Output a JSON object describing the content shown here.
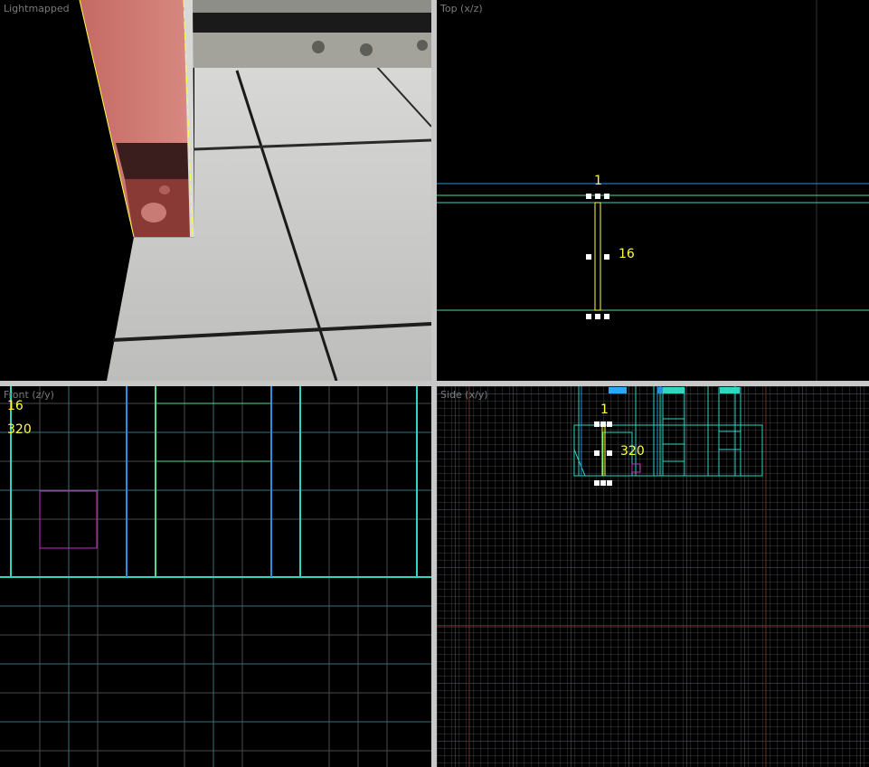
{
  "viewports": {
    "camera_3d": {
      "title": "Lightmapped"
    },
    "top": {
      "title": "Top (x/z)",
      "dim_width": "1",
      "dim_height": "16"
    },
    "front": {
      "title": "Front (z/y)",
      "dim_width": "16",
      "dim_height": "320"
    },
    "side": {
      "title": "Side (x/y)",
      "dim_width": "1",
      "dim_height": "320"
    }
  },
  "colors": {
    "viewport_bg": "#000000",
    "splitter": "#c8c8c8",
    "grid_line": "#4a4a4a",
    "grid_major": "#3c6e7a",
    "axis_line": "#7a2a1e",
    "brush_cyan": "#2fd6c0",
    "brush_blue": "#2a8fe0",
    "brush_green": "#54d890",
    "selected": "#ffff40",
    "entity_magenta": "#c030c0",
    "handle": "#ffffff",
    "title_text": "#7a7a7a"
  }
}
